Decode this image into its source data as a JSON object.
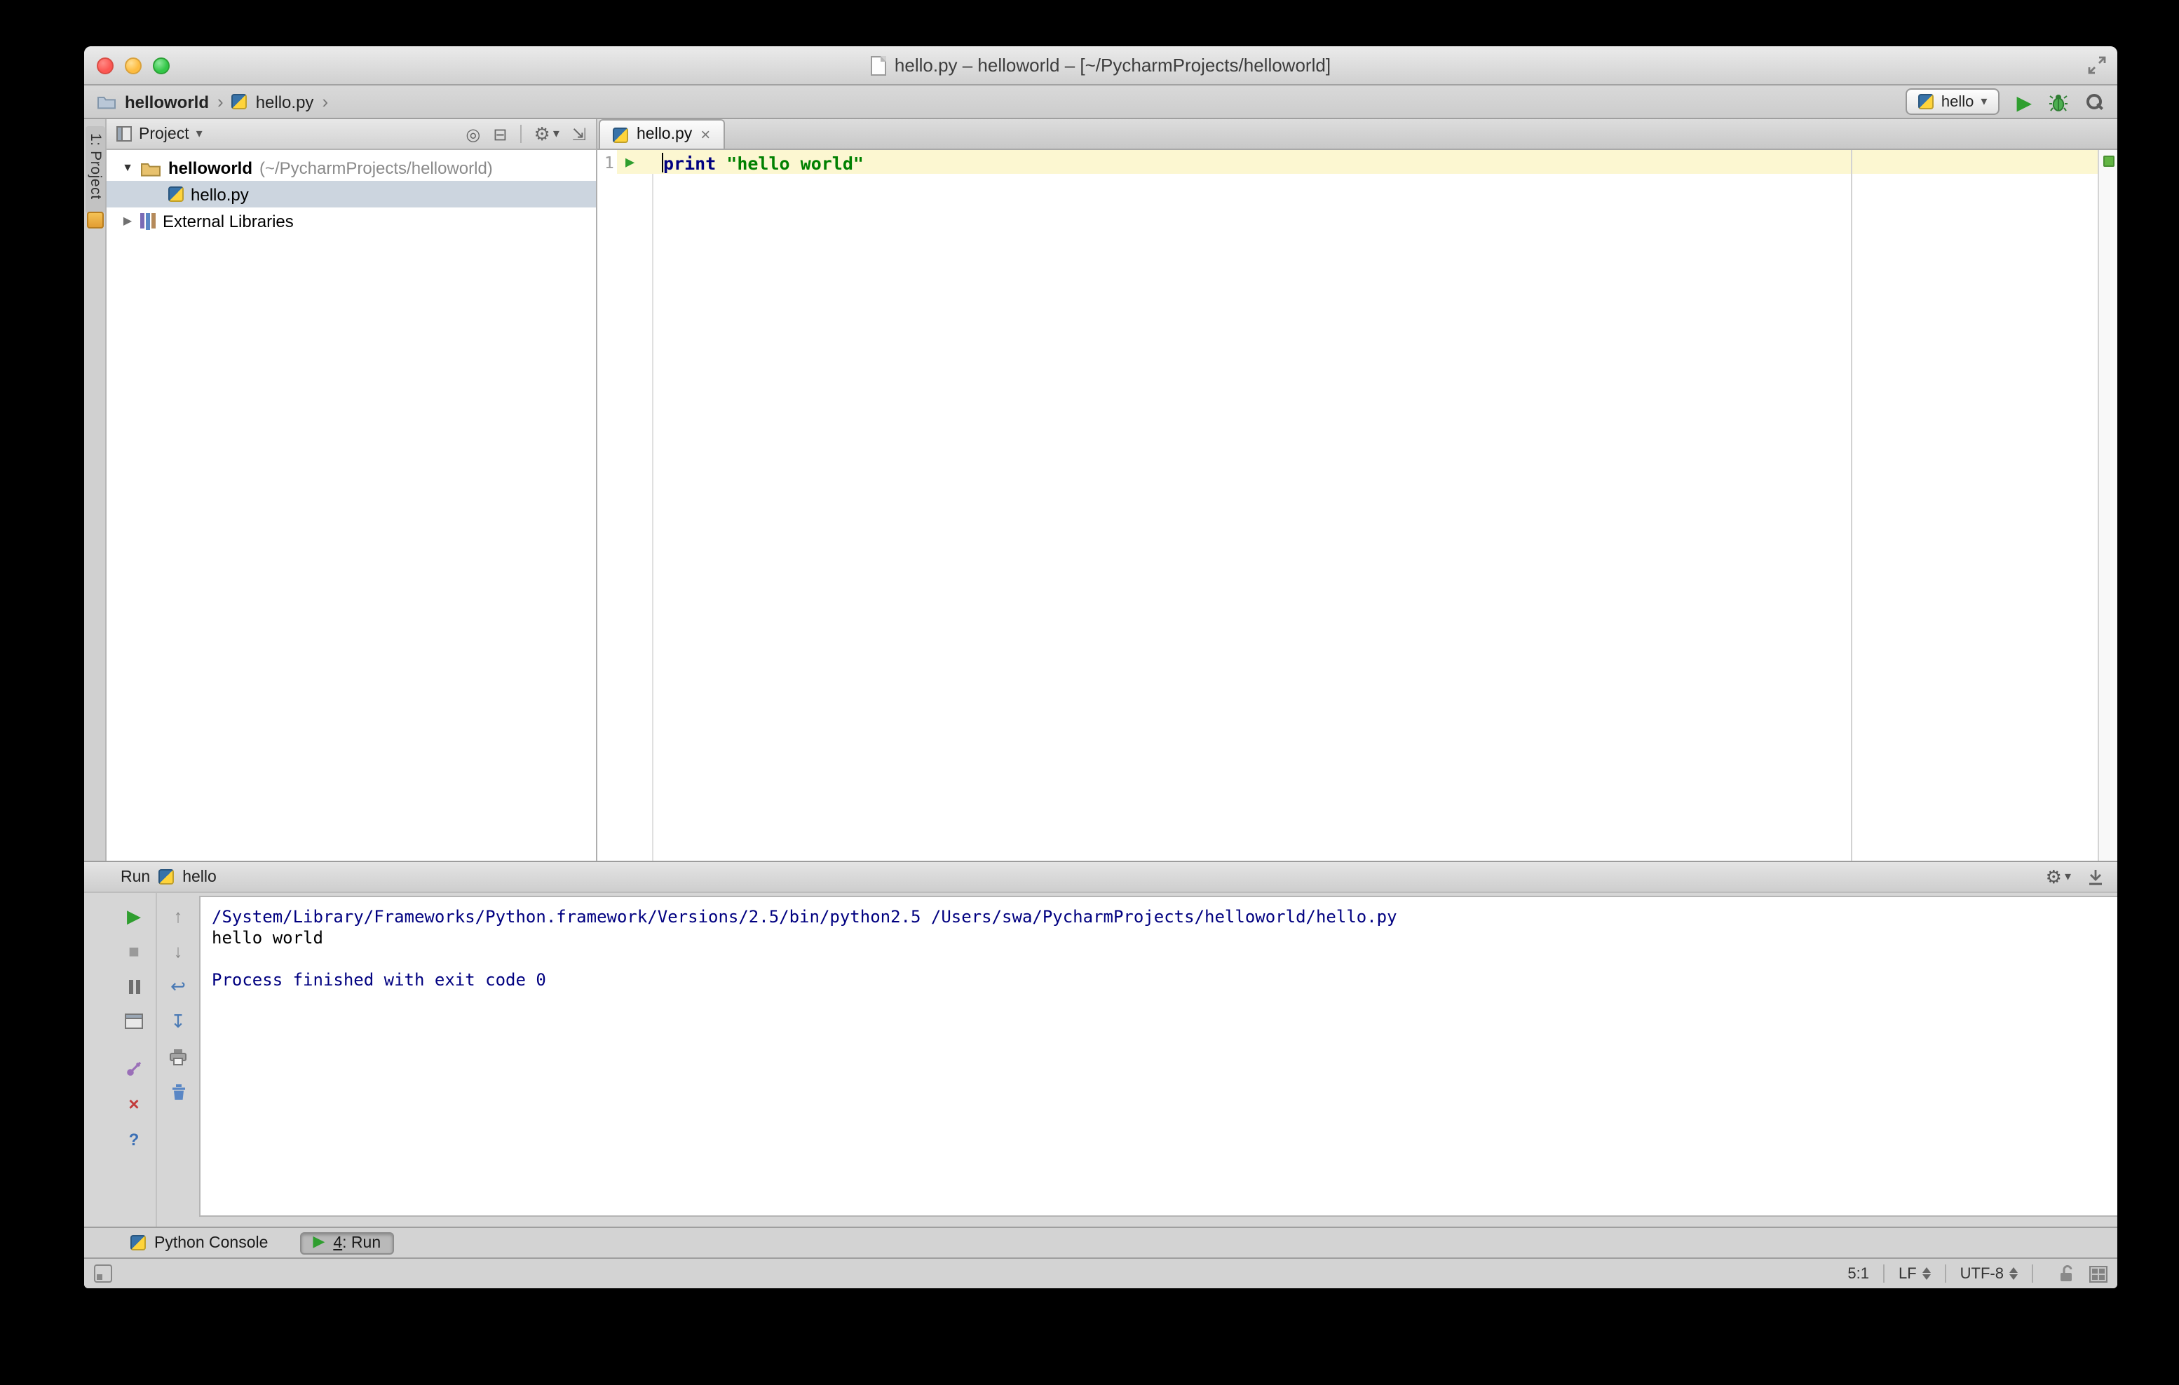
{
  "window": {
    "title": "hello.py – helloworld – [~/PycharmProjects/helloworld]"
  },
  "navbar": {
    "breadcrumb_project": "helloworld",
    "breadcrumb_file": "hello.py",
    "separator": "›",
    "run_config_name": "hello"
  },
  "tool_stripe": {
    "project_button": "1: Project"
  },
  "project_panel": {
    "view_selector": "Project",
    "root_name": "helloworld",
    "root_path": "(~/PycharmProjects/helloworld)",
    "file_name": "hello.py",
    "libraries_label": "External Libraries"
  },
  "editor": {
    "tab_title": "hello.py",
    "line_number": "1",
    "code_keyword": "print",
    "code_string": "\"hello world\""
  },
  "run_panel": {
    "panel_label": "Run",
    "config_name": "hello",
    "console_lines": [
      "/System/Library/Frameworks/Python.framework/Versions/2.5/bin/python2.5 /Users/swa/PycharmProjects/helloworld/hello.py",
      "hello world",
      "",
      "Process finished with exit code 0"
    ]
  },
  "bottom_bar": {
    "python_console_label": "Python Console",
    "run_tab_number": "4",
    "run_tab_label": ": Run"
  },
  "status_bar": {
    "caret_position": "5:1",
    "line_separator": "LF",
    "encoding": "UTF-8"
  },
  "colors": {
    "keyword": "#000080",
    "string": "#008000",
    "console_system": "#000080",
    "run_green": "#2f9e2f",
    "current_line_bg": "#fcf7d1",
    "selection_bg": "#ccd5df",
    "ok_indicator": "#62b543"
  },
  "icons": {
    "play": "▶",
    "stop": "■",
    "dropdown_arrow": "▾",
    "tree_expanded": "▼",
    "tree_collapsed": "▶",
    "close": "×",
    "up_arrow": "↑",
    "down_arrow": "↓",
    "soft_wrap": "↩",
    "scroll_end": "↧",
    "gear": "⚙",
    "locate": "◎",
    "collapse_all": "⊟",
    "hide_panel": "⇲",
    "help": "?"
  }
}
